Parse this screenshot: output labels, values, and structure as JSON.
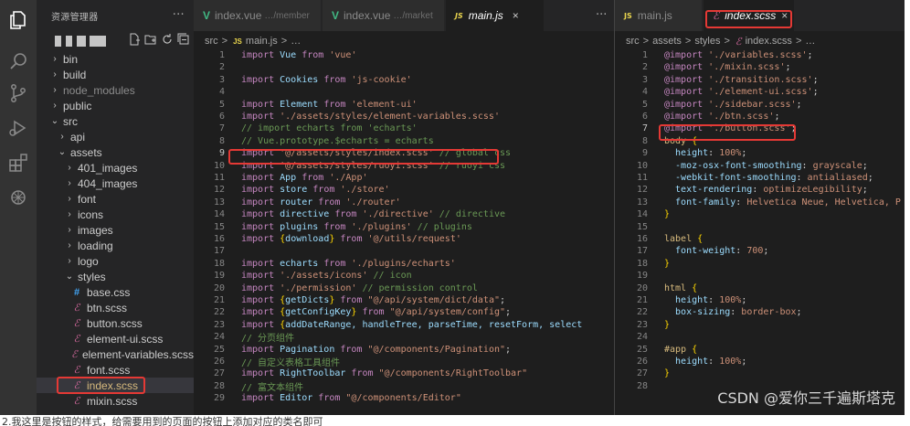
{
  "sidebar": {
    "title": "资源管理器",
    "more": "···",
    "items": [
      {
        "label": "bin",
        "depth": 1,
        "chev": "›",
        "kind": "folder"
      },
      {
        "label": "build",
        "depth": 1,
        "chev": "›",
        "kind": "folder"
      },
      {
        "label": "node_modules",
        "depth": 1,
        "chev": "›",
        "kind": "folder",
        "dim": true
      },
      {
        "label": "public",
        "depth": 1,
        "chev": "›",
        "kind": "folder"
      },
      {
        "label": "src",
        "depth": 1,
        "chev": "⌄",
        "kind": "folder"
      },
      {
        "label": "api",
        "depth": 2,
        "chev": "›",
        "kind": "folder"
      },
      {
        "label": "assets",
        "depth": 2,
        "chev": "⌄",
        "kind": "folder"
      },
      {
        "label": "401_images",
        "depth": 3,
        "chev": "›",
        "kind": "folder"
      },
      {
        "label": "404_images",
        "depth": 3,
        "chev": "›",
        "kind": "folder"
      },
      {
        "label": "font",
        "depth": 3,
        "chev": "›",
        "kind": "folder"
      },
      {
        "label": "icons",
        "depth": 3,
        "chev": "›",
        "kind": "folder"
      },
      {
        "label": "images",
        "depth": 3,
        "chev": "›",
        "kind": "folder"
      },
      {
        "label": "loading",
        "depth": 3,
        "chev": "›",
        "kind": "folder"
      },
      {
        "label": "logo",
        "depth": 3,
        "chev": "›",
        "kind": "folder"
      },
      {
        "label": "styles",
        "depth": 3,
        "chev": "⌄",
        "kind": "folder"
      },
      {
        "label": "base.css",
        "depth": 4,
        "icon": "#",
        "kind": "css"
      },
      {
        "label": "btn.scss",
        "depth": 4,
        "icon": "ℰ",
        "kind": "scss"
      },
      {
        "label": "button.scss",
        "depth": 4,
        "icon": "ℰ",
        "kind": "scss"
      },
      {
        "label": "element-ui.scss",
        "depth": 4,
        "icon": "ℰ",
        "kind": "scss"
      },
      {
        "label": "element-variables.scss",
        "depth": 4,
        "icon": "ℰ",
        "kind": "scss"
      },
      {
        "label": "font.scss",
        "depth": 4,
        "icon": "ℰ",
        "kind": "scss"
      },
      {
        "label": "index.scss",
        "depth": 4,
        "icon": "ℰ",
        "kind": "scss",
        "selected": true
      },
      {
        "label": "mixin.scss",
        "depth": 4,
        "icon": "ℰ",
        "kind": "scss"
      }
    ]
  },
  "left_editor": {
    "tabs": [
      {
        "label": "index.vue",
        "desc": "…/member",
        "type": "vue"
      },
      {
        "label": "index.vue",
        "desc": "…/market",
        "type": "vue"
      },
      {
        "label": "main.js",
        "desc": "",
        "type": "js",
        "active": true,
        "close": "×"
      }
    ],
    "more": "···",
    "breadcrumb": {
      "folder": "src",
      "sep": ">",
      "file": "main.js",
      "tail": "…"
    },
    "lines": [
      {
        "n": "1",
        "tokens": [
          [
            "kw",
            "import"
          ],
          [
            "id",
            " Vue "
          ],
          [
            "kw",
            "from"
          ],
          [
            "str",
            " 'vue'"
          ]
        ]
      },
      {
        "n": "2",
        "tokens": []
      },
      {
        "n": "3",
        "tokens": [
          [
            "kw",
            "import"
          ],
          [
            "id",
            " Cookies "
          ],
          [
            "kw",
            "from"
          ],
          [
            "str",
            " 'js-cookie'"
          ]
        ]
      },
      {
        "n": "4",
        "tokens": []
      },
      {
        "n": "5",
        "tokens": [
          [
            "kw",
            "import"
          ],
          [
            "id",
            " Element "
          ],
          [
            "kw",
            "from"
          ],
          [
            "str",
            " 'element-ui'"
          ]
        ]
      },
      {
        "n": "6",
        "tokens": [
          [
            "kw",
            "import"
          ],
          [
            "str",
            " './assets/styles/element-variables.scss'"
          ]
        ]
      },
      {
        "n": "7",
        "tokens": [
          [
            "cmt",
            "// import echarts from 'echarts'"
          ]
        ]
      },
      {
        "n": "8",
        "tokens": [
          [
            "cmt",
            "// Vue.prototype.$echarts = echarts"
          ]
        ]
      },
      {
        "n": "9",
        "tokens": [
          [
            "kw",
            "import"
          ],
          [
            "str",
            " '@/assets/styles/index.scss'"
          ],
          [
            "cmt",
            " // global css"
          ]
        ],
        "current": true
      },
      {
        "n": "10",
        "tokens": [
          [
            "kw",
            "import"
          ],
          [
            "str",
            " '@/assets/styles/ruoyi.scss'"
          ],
          [
            "cmt",
            " // ruoyi css"
          ]
        ]
      },
      {
        "n": "11",
        "tokens": [
          [
            "kw",
            "import"
          ],
          [
            "id",
            " App "
          ],
          [
            "kw",
            "from"
          ],
          [
            "str",
            " './App'"
          ]
        ]
      },
      {
        "n": "12",
        "tokens": [
          [
            "kw",
            "import"
          ],
          [
            "id",
            " store "
          ],
          [
            "kw",
            "from"
          ],
          [
            "str",
            " './store'"
          ]
        ]
      },
      {
        "n": "13",
        "tokens": [
          [
            "kw",
            "import"
          ],
          [
            "id",
            " router "
          ],
          [
            "kw",
            "from"
          ],
          [
            "str",
            " './router'"
          ]
        ]
      },
      {
        "n": "14",
        "tokens": [
          [
            "kw",
            "import"
          ],
          [
            "id",
            " directive "
          ],
          [
            "kw",
            "from"
          ],
          [
            "str",
            " './directive'"
          ],
          [
            "cmt",
            " // directive"
          ]
        ]
      },
      {
        "n": "15",
        "tokens": [
          [
            "kw",
            "import"
          ],
          [
            "id",
            " plugins "
          ],
          [
            "kw",
            "from"
          ],
          [
            "str",
            " './plugins'"
          ],
          [
            "cmt",
            " // plugins"
          ]
        ]
      },
      {
        "n": "16",
        "tokens": [
          [
            "kw",
            "import"
          ],
          [
            "br",
            " {"
          ],
          [
            "id",
            "download"
          ],
          [
            "br",
            "}"
          ],
          [
            "kw",
            " from"
          ],
          [
            "str",
            " '@/utils/request'"
          ]
        ]
      },
      {
        "n": "17",
        "tokens": []
      },
      {
        "n": "18",
        "tokens": [
          [
            "kw",
            "import"
          ],
          [
            "id",
            " echarts "
          ],
          [
            "kw",
            "from"
          ],
          [
            "str",
            " './plugins/echarts'"
          ]
        ]
      },
      {
        "n": "19",
        "tokens": [
          [
            "kw",
            "import"
          ],
          [
            "str",
            " './assets/icons'"
          ],
          [
            "cmt",
            " // icon"
          ]
        ]
      },
      {
        "n": "20",
        "tokens": [
          [
            "kw",
            "import"
          ],
          [
            "str",
            " './permission'"
          ],
          [
            "cmt",
            " // permission control"
          ]
        ]
      },
      {
        "n": "21",
        "tokens": [
          [
            "kw",
            "import"
          ],
          [
            "br",
            " {"
          ],
          [
            "id",
            "getDicts"
          ],
          [
            "br",
            "}"
          ],
          [
            "kw",
            " from"
          ],
          [
            "str",
            " \"@/api/system/dict/data\""
          ],
          [
            "src",
            ";"
          ]
        ]
      },
      {
        "n": "22",
        "tokens": [
          [
            "kw",
            "import"
          ],
          [
            "br",
            " {"
          ],
          [
            "id",
            "getConfigKey"
          ],
          [
            "br",
            "}"
          ],
          [
            "kw",
            " from"
          ],
          [
            "str",
            " \"@/api/system/config\""
          ],
          [
            "src",
            ";"
          ]
        ]
      },
      {
        "n": "23",
        "tokens": [
          [
            "kw",
            "import"
          ],
          [
            "br",
            " {"
          ],
          [
            "id",
            "addDateRange, handleTree, parseTime, resetForm, select"
          ]
        ]
      },
      {
        "n": "24",
        "tokens": [
          [
            "cmt",
            "// 分页组件"
          ]
        ]
      },
      {
        "n": "25",
        "tokens": [
          [
            "kw",
            "import"
          ],
          [
            "id",
            " Pagination "
          ],
          [
            "kw",
            "from"
          ],
          [
            "str",
            " \"@/components/Pagination\""
          ],
          [
            "src",
            ";"
          ]
        ]
      },
      {
        "n": "26",
        "tokens": [
          [
            "cmt",
            "// 自定义表格工具组件"
          ]
        ]
      },
      {
        "n": "27",
        "tokens": [
          [
            "kw",
            "import"
          ],
          [
            "id",
            " RightToolbar "
          ],
          [
            "kw",
            "from"
          ],
          [
            "str",
            " \"@/components/RightToolbar\""
          ]
        ]
      },
      {
        "n": "28",
        "tokens": [
          [
            "cmt",
            "// 富文本组件"
          ]
        ]
      },
      {
        "n": "29",
        "tokens": [
          [
            "kw",
            "import"
          ],
          [
            "id",
            " Editor "
          ],
          [
            "kw",
            "from"
          ],
          [
            "str",
            " \"@/components/Editor\""
          ]
        ]
      }
    ]
  },
  "right_editor": {
    "tabs": [
      {
        "label": "main.js",
        "type": "js"
      },
      {
        "label": "index.scss",
        "type": "scss",
        "active": true,
        "close": "×"
      }
    ],
    "breadcrumb": {
      "parts": [
        "src",
        "assets",
        "styles"
      ],
      "sep": ">",
      "file": "index.scss",
      "tail": "…"
    },
    "lines": [
      {
        "n": "1",
        "tokens": [
          [
            "at",
            "@import"
          ],
          [
            "str",
            " './variables.scss'"
          ],
          [
            "src",
            ";"
          ]
        ]
      },
      {
        "n": "2",
        "tokens": [
          [
            "at",
            "@import"
          ],
          [
            "str",
            " './mixin.scss'"
          ],
          [
            "src",
            ";"
          ]
        ]
      },
      {
        "n": "3",
        "tokens": [
          [
            "at",
            "@import"
          ],
          [
            "str",
            " './transition.scss'"
          ],
          [
            "src",
            ";"
          ]
        ]
      },
      {
        "n": "4",
        "tokens": [
          [
            "at",
            "@import"
          ],
          [
            "str",
            " './element-ui.scss'"
          ],
          [
            "src",
            ";"
          ]
        ]
      },
      {
        "n": "5",
        "tokens": [
          [
            "at",
            "@import"
          ],
          [
            "str",
            " './sidebar.scss'"
          ],
          [
            "src",
            ";"
          ]
        ]
      },
      {
        "n": "6",
        "tokens": [
          [
            "at",
            "@import"
          ],
          [
            "str",
            " './btn.scss'"
          ],
          [
            "src",
            ";"
          ]
        ]
      },
      {
        "n": "7",
        "tokens": [
          [
            "at",
            "@import"
          ],
          [
            "str",
            " './button.scss'"
          ],
          [
            "src",
            ";"
          ]
        ],
        "current": true
      },
      {
        "n": "8",
        "tokens": [
          [
            "sel",
            "body"
          ],
          [
            "br",
            " {"
          ]
        ]
      },
      {
        "n": "9",
        "tokens": [
          [
            "pr",
            "  height"
          ],
          [
            "src",
            ": "
          ],
          [
            "vl",
            "100%"
          ],
          [
            "src",
            ";"
          ]
        ]
      },
      {
        "n": "10",
        "tokens": [
          [
            "pr",
            "  -moz-osx-font-smoothing"
          ],
          [
            "src",
            ": "
          ],
          [
            "vl",
            "grayscale"
          ],
          [
            "src",
            ";"
          ]
        ]
      },
      {
        "n": "11",
        "tokens": [
          [
            "pr",
            "  -webkit-font-smoothing"
          ],
          [
            "src",
            ": "
          ],
          [
            "vl",
            "antialiased"
          ],
          [
            "src",
            ";"
          ]
        ]
      },
      {
        "n": "12",
        "tokens": [
          [
            "pr",
            "  text-rendering"
          ],
          [
            "src",
            ": "
          ],
          [
            "vl",
            "optimizeLegibility"
          ],
          [
            "src",
            ";"
          ]
        ]
      },
      {
        "n": "13",
        "tokens": [
          [
            "pr",
            "  font-family"
          ],
          [
            "src",
            ": "
          ],
          [
            "vl",
            "Helvetica Neue, Helvetica, P"
          ]
        ]
      },
      {
        "n": "14",
        "tokens": [
          [
            "br",
            "}"
          ]
        ]
      },
      {
        "n": "15",
        "tokens": []
      },
      {
        "n": "16",
        "tokens": [
          [
            "sel",
            "label"
          ],
          [
            "br",
            " {"
          ]
        ]
      },
      {
        "n": "17",
        "tokens": [
          [
            "pr",
            "  font-weight"
          ],
          [
            "src",
            ": "
          ],
          [
            "vl",
            "700"
          ],
          [
            "src",
            ";"
          ]
        ]
      },
      {
        "n": "18",
        "tokens": [
          [
            "br",
            "}"
          ]
        ]
      },
      {
        "n": "19",
        "tokens": []
      },
      {
        "n": "20",
        "tokens": [
          [
            "sel",
            "html"
          ],
          [
            "br",
            " {"
          ]
        ]
      },
      {
        "n": "21",
        "tokens": [
          [
            "pr",
            "  height"
          ],
          [
            "src",
            ": "
          ],
          [
            "vl",
            "100%"
          ],
          [
            "src",
            ";"
          ]
        ]
      },
      {
        "n": "22",
        "tokens": [
          [
            "pr",
            "  box-sizing"
          ],
          [
            "src",
            ": "
          ],
          [
            "vl",
            "border-box"
          ],
          [
            "src",
            ";"
          ]
        ]
      },
      {
        "n": "23",
        "tokens": [
          [
            "br",
            "}"
          ]
        ]
      },
      {
        "n": "24",
        "tokens": []
      },
      {
        "n": "25",
        "tokens": [
          [
            "sel",
            "#app"
          ],
          [
            "br",
            " {"
          ]
        ]
      },
      {
        "n": "26",
        "tokens": [
          [
            "pr",
            "  height"
          ],
          [
            "src",
            ": "
          ],
          [
            "vl",
            "100%"
          ],
          [
            "src",
            ";"
          ]
        ]
      },
      {
        "n": "27",
        "tokens": [
          [
            "br",
            "}"
          ]
        ]
      },
      {
        "n": "28",
        "tokens": []
      }
    ]
  },
  "watermark": "CSDN @爱你三千遍斯塔克",
  "caption": "2.我这里是按钮的样式，给需要用到的页面的按钮上添加对应的类名即可"
}
